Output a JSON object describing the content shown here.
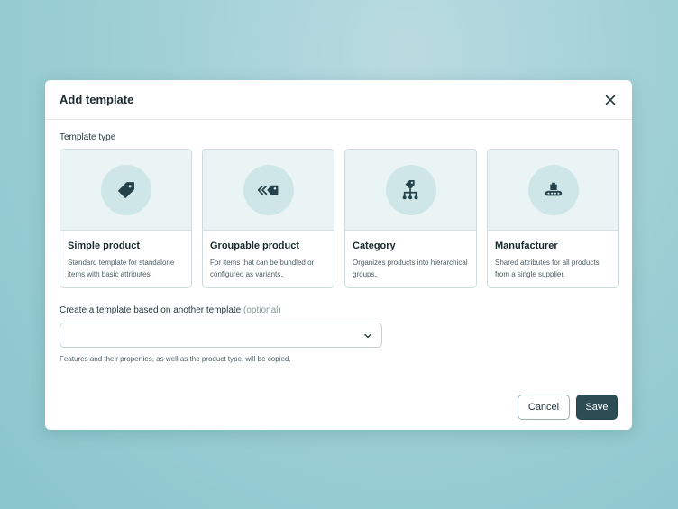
{
  "dialog": {
    "title": "Add template",
    "section_label": "Template type",
    "cards": [
      {
        "title": "Simple product",
        "description": "Standard template for standalone items with basic attributes.",
        "icon": "tag-icon"
      },
      {
        "title": "Groupable product",
        "description": "For items that can be bundled or configured as variants.",
        "icon": "grouped-tags-icon"
      },
      {
        "title": "Category",
        "description": "Organizes products into hierarchical groups.",
        "icon": "hierarchy-tag-icon"
      },
      {
        "title": "Manufacturer",
        "description": "Shared attributes for all products from a single supplier.",
        "icon": "conveyor-icon"
      }
    ],
    "based_on_label": "Create a template based on another template",
    "based_on_optional": "(optional)",
    "based_on_value": "",
    "hint": "Features and their properties, as well as the product type, will be copied.",
    "cancel_label": "Cancel",
    "save_label": "Save"
  },
  "colors": {
    "primary": "#2d4d55",
    "icon": "#24424a",
    "card_header_bg": "#eaf4f5",
    "icon_circle_bg": "#cfe6e9"
  }
}
